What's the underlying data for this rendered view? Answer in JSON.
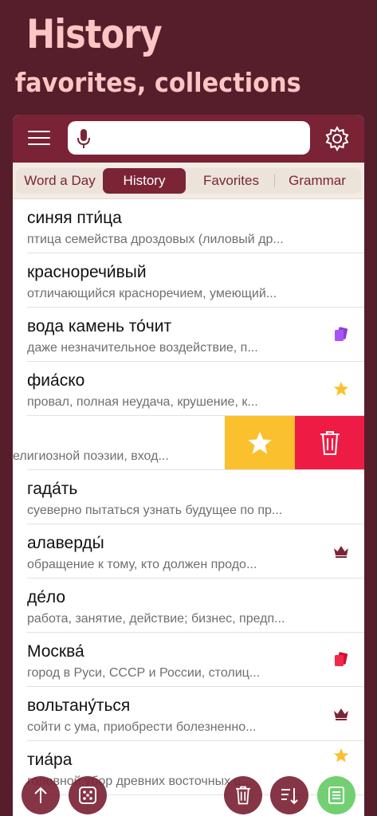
{
  "promo": {
    "title": "History",
    "subtitle": "favorites, collections"
  },
  "colors": {
    "background": "#561e2b",
    "accent": "#7b2436",
    "promo_text": "#fbc6c4",
    "favorite": "#fbc02d",
    "delete": "#ee1c44",
    "collection_purple": "#a855f7",
    "collection_red": "#f0284a",
    "fab_green": "#72d073"
  },
  "search": {
    "value": "",
    "placeholder": ""
  },
  "tabs": [
    {
      "label": "Word a Day",
      "active": false
    },
    {
      "label": "History",
      "active": true
    },
    {
      "label": "Favorites",
      "active": false
    },
    {
      "label": "Grammar",
      "active": false
    }
  ],
  "entries": [
    {
      "word": "синяя пти́ца",
      "definition": "птица семейства дроздовых (лиловый др...",
      "mark": "none"
    },
    {
      "word": "красноречи́вый",
      "definition": "отличающийся красноречием, умеющий...",
      "mark": "none"
    },
    {
      "word": "вода камень то́чит",
      "definition": "даже незначительное воздействие, п...",
      "mark": "cards-purple-icon"
    },
    {
      "word": "фиа́ско",
      "definition": "провал, полная неудача, крушение, к...",
      "mark": "star-icon"
    },
    {
      "word": "",
      "definition": "елигиозной поэзии, вход...",
      "mark": "swipe-actions"
    },
    {
      "word": "гада́ть",
      "definition": "суеверно пытаться узнать будущее по пр...",
      "mark": "none"
    },
    {
      "word": "алаверды́",
      "definition": "обращение к тому, кто должен продо...",
      "mark": "crown-icon"
    },
    {
      "word": "де́ло",
      "definition": "работа, занятие, действие; бизнес, предп...",
      "mark": "none"
    },
    {
      "word": "Москва́",
      "definition": "город в Руси, СССР и России, столиц...",
      "mark": "cards-red-icon"
    },
    {
      "word": "вольтану́ться",
      "definition": "сойти с ума, приобрести болезненно...",
      "mark": "crown-icon"
    },
    {
      "word": "тиа́ра",
      "definition": "головной убор древних восточных ц...",
      "mark": "star-icon"
    }
  ],
  "fabs": [
    "arrow-up-icon",
    "dice-icon",
    "trash-icon",
    "sort-icon",
    "list-icon"
  ]
}
